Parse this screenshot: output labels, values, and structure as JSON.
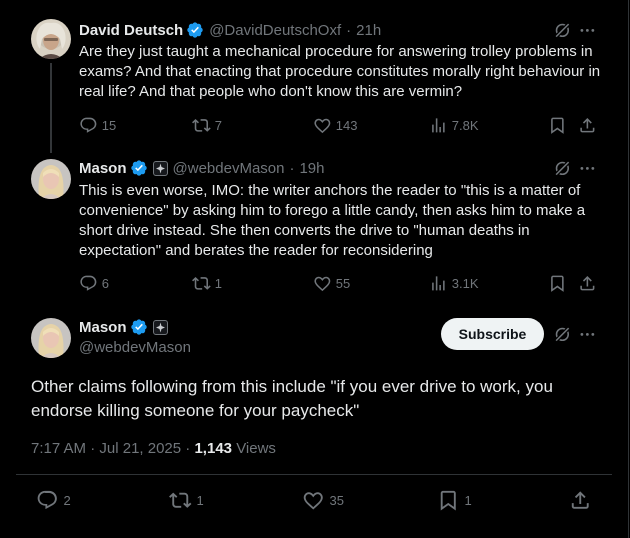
{
  "tweets": [
    {
      "name": "David Deutsch",
      "handle": "@DavidDeutschOxf",
      "time": "21h",
      "text": "Are they just taught a mechanical procedure for answering trolley problems in exams? And that enacting that procedure constitutes morally right behaviour in real life? And that people who don't know this are vermin?",
      "replies": "15",
      "reposts": "7",
      "likes": "143",
      "views": "7.8K"
    },
    {
      "name": "Mason",
      "handle": "@webdevMason",
      "time": "19h",
      "text": "This is even worse, IMO: the writer anchors the reader to \"this is a matter of convenience\" by asking him to forego a little candy, then asks him to make a short drive instead. She then converts the drive to \"human deaths in expectation\" and berates the reader for reconsidering",
      "replies": "6",
      "reposts": "1",
      "likes": "55",
      "views": "3.1K"
    }
  ],
  "main": {
    "name": "Mason",
    "handle": "@webdevMason",
    "subscribe_label": "Subscribe",
    "text": "Other claims following from this include \"if you ever drive to work, you endorse killing someone for your paycheck\"",
    "time": "7:17 AM",
    "date": "Jul 21, 2025",
    "views_count": "1,143",
    "views_label": "Views",
    "replies": "2",
    "reposts": "1",
    "likes": "35",
    "bookmarks": "1"
  },
  "separator": "·",
  "colors": {
    "background": "#000000",
    "text": "#e7e9ea",
    "secondary": "#71767b",
    "verified": "#1d9bf0",
    "divider": "#2f3336"
  },
  "icons": [
    "verified-badge-icon",
    "grok-icon",
    "more-icon",
    "reply-icon",
    "repost-icon",
    "like-icon",
    "views-icon",
    "bookmark-icon",
    "share-icon",
    "affiliate-badge-icon"
  ]
}
